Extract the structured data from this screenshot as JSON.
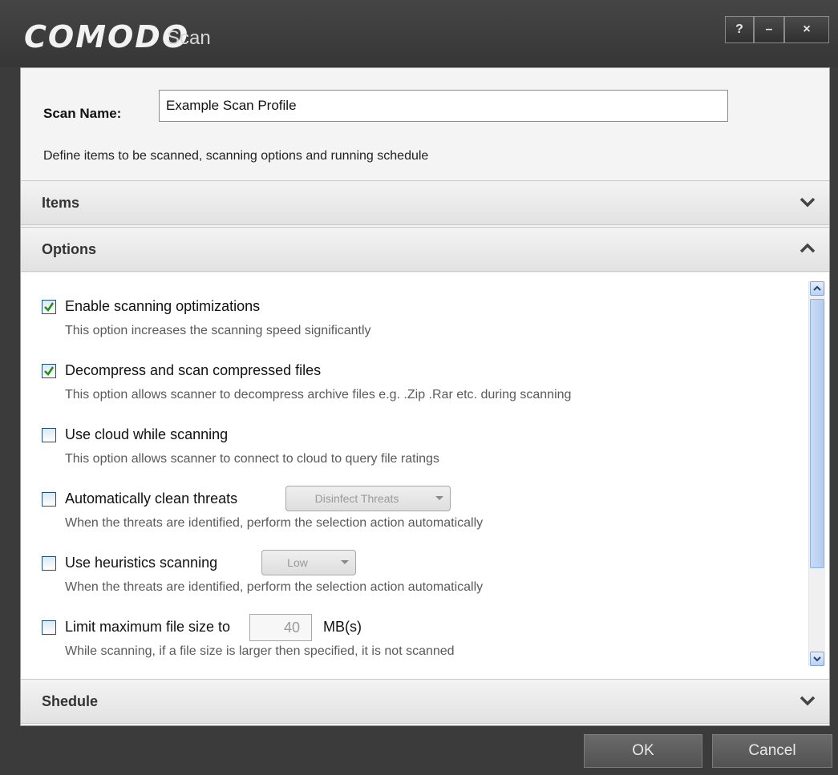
{
  "titlebar": {
    "brand": "COMODO",
    "title": "Scan",
    "help_label": "?",
    "minimize_label": "–",
    "close_label": "×"
  },
  "scan_name": {
    "label": "Scan Name:",
    "value": "Example Scan Profile"
  },
  "description": "Define items to be scanned, scanning options and running schedule",
  "sections": {
    "items": {
      "title": "Items",
      "state": "collapsed"
    },
    "options": {
      "title": "Options",
      "state": "expanded"
    },
    "schedule": {
      "title": "Shedule",
      "state": "collapsed"
    }
  },
  "options": [
    {
      "label": "Enable scanning optimizations",
      "checked": true,
      "description": "This option increases the scanning speed significantly"
    },
    {
      "label": "Decompress and scan compressed files",
      "checked": true,
      "description": "This option allows scanner to decompress archive files e.g. .Zip .Rar etc. during scanning"
    },
    {
      "label": "Use cloud while scanning",
      "checked": false,
      "description": "This option allows scanner to connect to cloud to query file ratings"
    },
    {
      "label": "Automatically clean threats",
      "checked": false,
      "description": "When the threats are identified, perform the selection action automatically",
      "select_value": "Disinfect Threats"
    },
    {
      "label": "Use heuristics scanning",
      "checked": false,
      "description": "When the threats are identified, perform the selection action automatically",
      "select_value": "Low"
    },
    {
      "label": "Limit maximum file size to",
      "checked": false,
      "description": "While scanning, if a file size is larger then specified, it is not scanned",
      "number_value": "40",
      "unit": "MB(s)"
    }
  ],
  "buttons": {
    "ok": "OK",
    "cancel": "Cancel"
  },
  "colors": {
    "titlebar_bg": "#3b3b3b",
    "panel_bg": "#f4f4f4",
    "checkmark": "#2a8a1e",
    "scroll_accent": "#b4ccef"
  }
}
